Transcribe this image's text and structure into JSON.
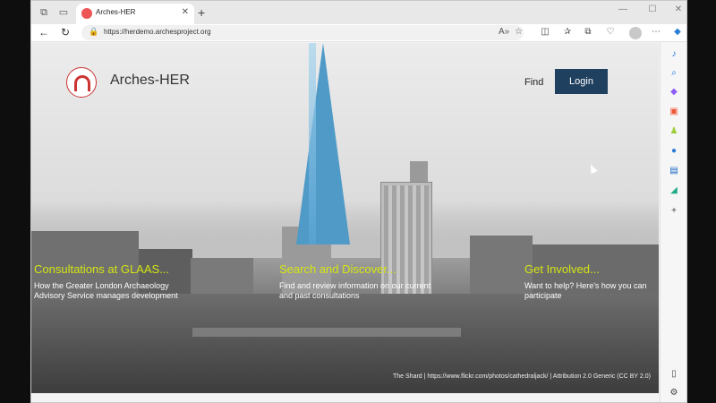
{
  "browser": {
    "tab_title": "Arches-HER",
    "tab_close": "✕",
    "new_tab": "+",
    "url": "https://herdemo.archesproject.org",
    "window_controls": [
      "—",
      "☐",
      "✕"
    ]
  },
  "header": {
    "site_title": "Arches-HER",
    "find_label": "Find",
    "login_label": "Login"
  },
  "features": [
    {
      "title": "Consultations at GLAAS...",
      "text": "How the Greater London Archaeology Advisory Service manages development"
    },
    {
      "title": "Search and Discover...",
      "text": "Find and review information on our current and past consultations"
    },
    {
      "title": "Get Involved...",
      "text": "Want to help? Here's how you can participate"
    }
  ],
  "credit": "The Shard | https://www.flickr.com/photos/cathedraljack/ | Attribution 2.0 Generic (CC BY 2.0)",
  "colors": {
    "accent": "#d4e612",
    "login_bg": "#20405f",
    "logo_red": "#cc3333"
  },
  "icons": [
    "back-icon",
    "refresh-icon",
    "lock-icon",
    "read-aloud-icon",
    "favorite-star-icon",
    "split-screen-icon",
    "favorites-icon",
    "collections-icon",
    "extensions-icon",
    "profile-icon",
    "more-icon",
    "copilot-icon"
  ]
}
